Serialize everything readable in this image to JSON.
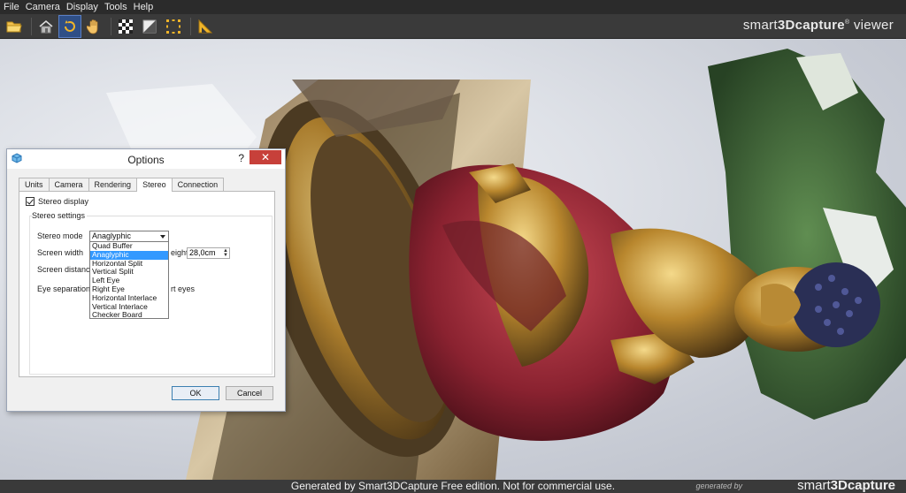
{
  "menu": [
    "File",
    "Camera",
    "Display",
    "Tools",
    "Help"
  ],
  "toolbar": {
    "buttons": [
      "open-folder-icon",
      "home-icon",
      "rotate-icon",
      "pan-hand-icon",
      "checker-texture-icon",
      "shading-icon",
      "selection-bounds-icon",
      "measure-ruler-icon"
    ],
    "brand_prefix": "smart",
    "brand_bold": "3Dcapture",
    "brand_reg": "®",
    "brand_suffix": " viewer"
  },
  "dialog": {
    "title": "Options",
    "help": "?",
    "close": "✕",
    "tabs": [
      "Units",
      "Camera",
      "Rendering",
      "Stereo",
      "Connection"
    ],
    "active_tab": "Stereo",
    "stereo_display_label": "Stereo display",
    "stereo_display_checked": true,
    "group_label": "Stereo settings",
    "stereo_mode_label": "Stereo mode",
    "stereo_mode_value": "Anaglyphic",
    "screen_width_label": "Screen width",
    "screen_height_label_partial": "eight",
    "screen_height_value": "28,0cm",
    "screen_distance_label": "Screen distanc",
    "eye_separation_label": "Eye separation",
    "eye_separation_suffix": "rt eyes",
    "options": [
      "Quad Buffer",
      "Anaglyphic",
      "Horizontal Split",
      "Vertical Split",
      "Left Eye",
      "Right Eye",
      "Horizontal Interlace",
      "Vertical Interlace",
      "Checker Board"
    ],
    "selected_option": "Anaglyphic",
    "ok": "OK",
    "cancel": "Cancel"
  },
  "footer": {
    "notice": "Generated by Smart3DCapture Free edition. Not for commercial use.",
    "generated_by": "generated by",
    "brand_prefix": "smart",
    "brand_bold": "3Dcapture"
  },
  "colors": {
    "selected_blue": "#3399ff",
    "close_red": "#c7403a",
    "toolbar_active": "#2f4f86"
  }
}
